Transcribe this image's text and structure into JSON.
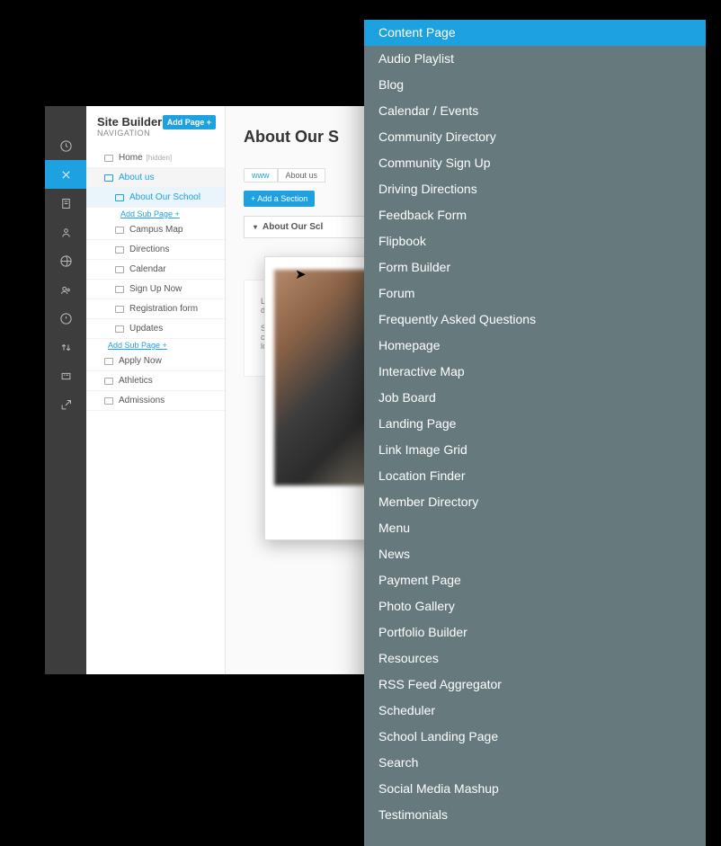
{
  "sidebar": {
    "title": "Site Builder",
    "subtitle": "NAVIGATION",
    "add_page": "Add Page +",
    "add_sub": "Add Sub Page +",
    "nodes": [
      {
        "label": "Home",
        "hidden": "[hidden]",
        "depth": 0
      },
      {
        "label": "About us",
        "depth": 0,
        "sel": true
      },
      {
        "label": "About Our School",
        "depth": 1,
        "sel2": true
      },
      {
        "label": "Campus Map",
        "depth": 1
      },
      {
        "label": "Directions",
        "depth": 1
      },
      {
        "label": "Calendar",
        "depth": 1
      },
      {
        "label": "Sign Up Now",
        "depth": 1
      },
      {
        "label": "Registration form",
        "depth": 1
      },
      {
        "label": "Updates",
        "depth": 1
      },
      {
        "label": "Apply Now",
        "depth": 0
      },
      {
        "label": "Athletics",
        "depth": 0
      },
      {
        "label": "Admissions",
        "depth": 0
      }
    ]
  },
  "main": {
    "title": "About Our S",
    "crumb1": "www",
    "crumb2": "About us",
    "add_section": "+ Add a Section",
    "section_label": "About Our Scl",
    "lorem1": "Lorem ips",
    "lorem1b": "dapibus l",
    "lorem2": "Sed egest",
    "lorem2b": "commod",
    "lorem2c": "lorem. M"
  },
  "dropdown": {
    "options": [
      "Content Page",
      "Audio Playlist",
      "Blog",
      "Calendar / Events",
      "Community Directory",
      "Community Sign Up",
      "Driving Directions",
      "Feedback Form",
      "Flipbook",
      "Form Builder",
      "Forum",
      "Frequently Asked Questions",
      "Homepage",
      "Interactive Map",
      "Job Board",
      "Landing Page",
      "Link Image Grid",
      "Location Finder",
      "Member Directory",
      "Menu",
      "News",
      "Payment Page",
      "Photo Gallery",
      "Portfolio Builder",
      "Resources",
      "RSS Feed Aggregator",
      "Scheduler",
      "School Landing Page",
      "Search",
      "Social Media Mashup",
      "Testimonials"
    ],
    "selected": 0
  }
}
